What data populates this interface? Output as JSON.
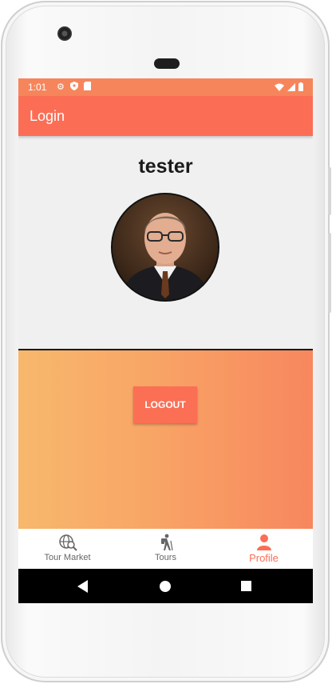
{
  "status_bar": {
    "time": "1:01"
  },
  "app_bar": {
    "title": "Login"
  },
  "profile": {
    "username": "tester"
  },
  "actions": {
    "logout_label": "LOGOUT"
  },
  "bottom_nav": {
    "items": [
      {
        "label": "Tour Market",
        "icon": "globe-search-icon",
        "active": false
      },
      {
        "label": "Tours",
        "icon": "hiker-icon",
        "active": false
      },
      {
        "label": "Profile",
        "icon": "person-icon",
        "active": true
      }
    ]
  },
  "colors": {
    "status_bar": "#f7855c",
    "app_bar": "#fb6e55",
    "accent": "#fb6e55",
    "gradient_start": "#f7b86c",
    "gradient_end": "#f7875e"
  }
}
